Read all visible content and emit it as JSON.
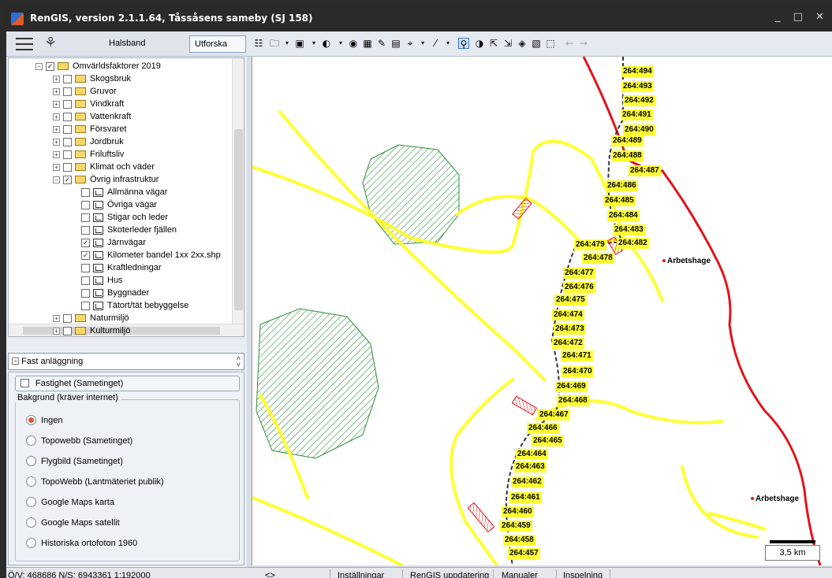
{
  "window": {
    "title": "RenGIS, version 2.1.1.64, Tåssåsens sameby (SJ 158)",
    "controls": "_ □ ✕"
  },
  "left_toolbar": {
    "tab_halsband": "Halsband",
    "tab_utforska": "Utforska"
  },
  "tree": {
    "root": "Omvärldsfaktorer 2019",
    "items": [
      {
        "label": "Skogsbruk",
        "checked": false
      },
      {
        "label": "Gruvor",
        "checked": false
      },
      {
        "label": "Vindkraft",
        "checked": false
      },
      {
        "label": "Vattenkraft",
        "checked": false
      },
      {
        "label": "Försvaret",
        "checked": false
      },
      {
        "label": "Jordbruk",
        "checked": false
      },
      {
        "label": "Friluftsliv",
        "checked": false
      },
      {
        "label": "Klimat och väder",
        "checked": false
      },
      {
        "label": "Övrig infrastruktur",
        "checked": true
      }
    ],
    "layers": [
      {
        "label": "Allmänna vägar",
        "checked": false
      },
      {
        "label": "Övriga vägar",
        "checked": false
      },
      {
        "label": "Stigar och leder",
        "checked": false
      },
      {
        "label": "Skoterleder fjällen",
        "checked": false
      },
      {
        "label": "Järnvägar",
        "checked": true
      },
      {
        "label": "Kilometer bandel 1xx 2xx.shp",
        "checked": true
      },
      {
        "label": "Kraftledningar",
        "checked": false
      },
      {
        "label": "Hus",
        "checked": false
      },
      {
        "label": "Byggnader",
        "checked": false
      },
      {
        "label": "Tätort/tät bebyggelse",
        "checked": false
      }
    ],
    "after": "Naturmiljö",
    "partial": "Kulturmiljö"
  },
  "selector": {
    "value": "Fast anläggning"
  },
  "panel": {
    "fastighet": "Fastighet (Sametinget)",
    "group_label": "Bakgrund (kräver internet)",
    "options": [
      {
        "label": "Ingen",
        "selected": true
      },
      {
        "label": "Topowebb (Sametinget)",
        "selected": false
      },
      {
        "label": "Flygbild (Sametinget)",
        "selected": false
      },
      {
        "label": "TopoWebb (Lantmäteriet publik)",
        "selected": false
      },
      {
        "label": "Google Maps karta",
        "selected": false
      },
      {
        "label": "Google Maps satellit",
        "selected": false
      },
      {
        "label": "Historiska ortofoton 1960",
        "selected": false
      }
    ]
  },
  "map": {
    "km_labels": [
      "264:494",
      "264:493",
      "264:492",
      "264:491",
      "264:490",
      "264:489",
      "264:488",
      "264:487",
      "264:486",
      "264:485",
      "264:484",
      "264:483",
      "264:482",
      "264:479",
      "264:478",
      "264:477",
      "264:476",
      "264:475",
      "264:474",
      "264:473",
      "264:472",
      "264:471",
      "264:470",
      "264:469",
      "264:468",
      "264:467",
      "264:466",
      "264:465",
      "264:464",
      "264:463",
      "264:462",
      "264:461",
      "264:460",
      "264:459",
      "264:458",
      "264:457"
    ],
    "places": [
      "Arbetshage",
      "Arbetshage"
    ],
    "scale": "3,5 km"
  },
  "status": {
    "coords": "Ö/V: 468686 N/S: 6943361 1:192000",
    "arrows": "<>",
    "installningar": "Inställningar",
    "update": "RenGIS uppdatering",
    "manualer": "Manualer",
    "inspelning": "Inspelning"
  },
  "colors": {
    "road": "#ffff33",
    "red_line": "#e0141b",
    "forest": "#2f8f3a",
    "label_bg": "#ffff33"
  }
}
